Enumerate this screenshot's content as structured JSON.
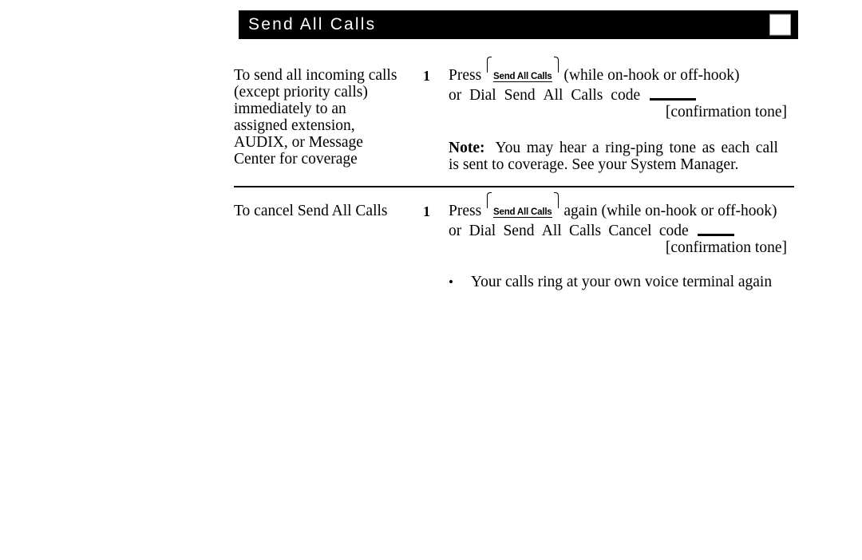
{
  "header": {
    "title": "Send All Calls",
    "marker_icon": "white-square-icon"
  },
  "sections": [
    {
      "id": "send-all-calls",
      "description_lines": [
        "To send all incoming calls",
        "(except priority calls)",
        "immediately to an",
        "assigned extension,",
        "AUDIX, or Message",
        "Center for coverage"
      ],
      "step_number": "1",
      "instruction": {
        "press_word": "Press",
        "key_label": "Send All Calls",
        "after_key": "(while on-hook or off-hook)",
        "alt_line_words": [
          "or",
          "Dial",
          "Send",
          "All",
          "Calls",
          "code"
        ],
        "blank_field": "",
        "result": "[confirmation tone]"
      },
      "note": {
        "label": "Note:",
        "line_1_words": [
          "You",
          "may",
          "hear",
          "a",
          "ring-ping",
          "tone",
          "as",
          "each",
          "call"
        ],
        "line_2": "is sent to coverage. See your System Manager."
      }
    },
    {
      "id": "cancel-send-all-calls",
      "description_lines": [
        "To cancel Send All Calls"
      ],
      "step_number": "1",
      "instruction": {
        "press_word": "Press",
        "key_label": "Send All Calls",
        "after_key": "again (while on-hook or off-hook)",
        "alt_line_words": [
          "or",
          "Dial",
          "Send",
          "All",
          "Calls",
          "Cancel",
          "code"
        ],
        "blank_field": "",
        "result": "[confirmation tone]"
      },
      "bullet": {
        "marker": "•",
        "text": "Your calls ring at your own voice terminal again"
      }
    }
  ]
}
